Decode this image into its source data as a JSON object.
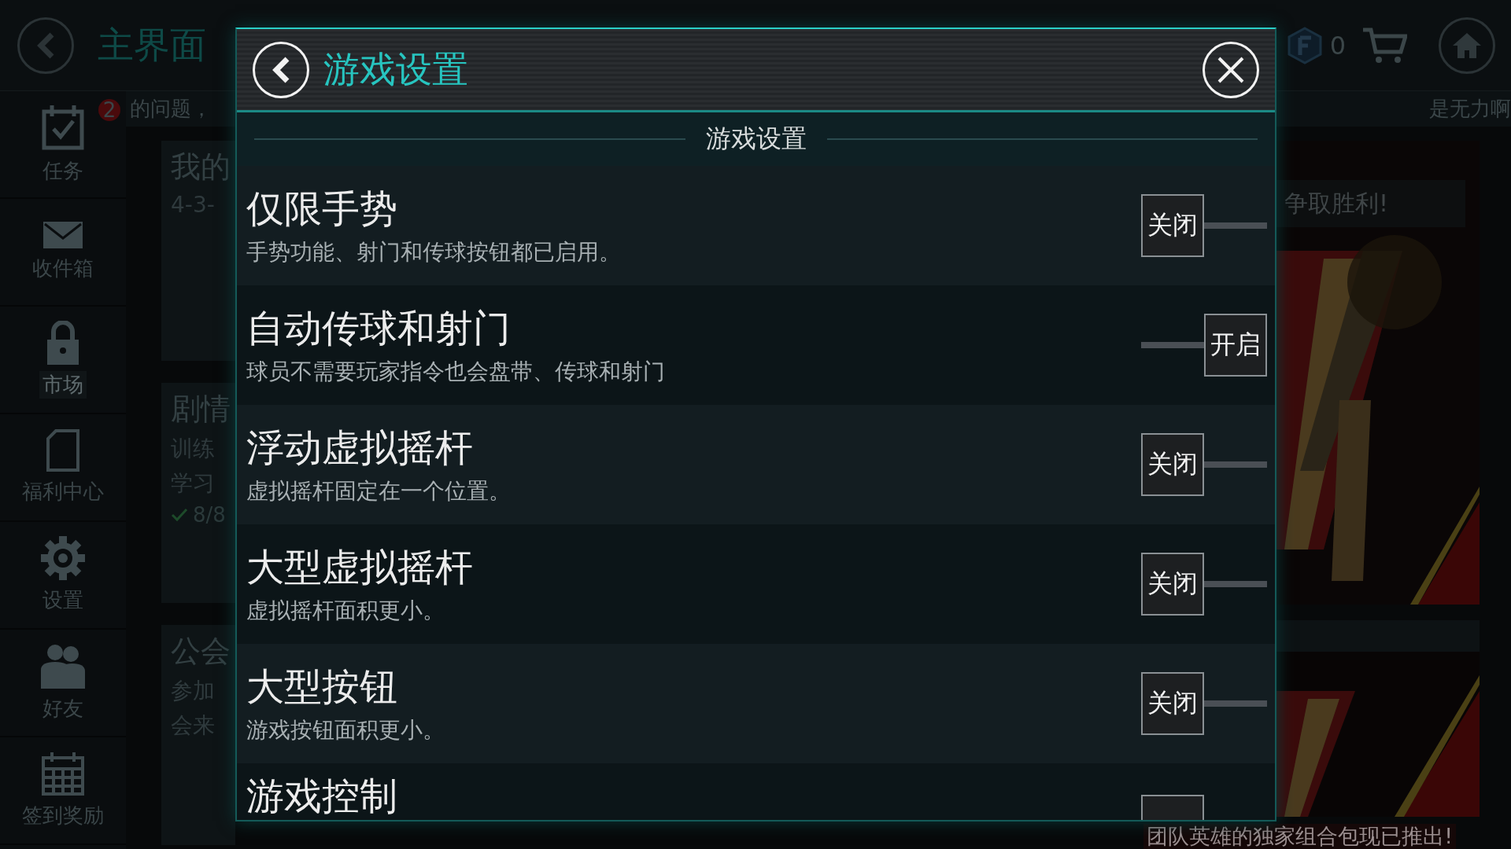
{
  "background": {
    "title": "主界面",
    "badge": "2",
    "ticker_left": "的问题，",
    "ticker_right": "是无力啊",
    "coins": "0",
    "sidebar": [
      {
        "label": "任务",
        "disabled": false
      },
      {
        "label": "收件箱",
        "disabled": false
      },
      {
        "label": "市场",
        "disabled": true
      },
      {
        "label": "福利中心",
        "disabled": false
      },
      {
        "label": "设置",
        "disabled": false
      },
      {
        "label": "好友",
        "disabled": false
      },
      {
        "label": "签到奖励",
        "disabled": false
      }
    ],
    "cards": [
      {
        "title": "我的",
        "lines": [
          "4-3-"
        ]
      },
      {
        "title": "剧情",
        "lines": [
          "训练",
          "学习"
        ],
        "progress": "8/8"
      },
      {
        "title": "公会",
        "lines": [
          "参加",
          "会来"
        ]
      }
    ],
    "banner_text": "争取胜利!",
    "footer_text": "团队英雄的独家组合包现已推出!"
  },
  "dialog": {
    "title": "游戏设置",
    "section": "游戏设置",
    "settings": [
      {
        "title": "仅限手势",
        "description": "手势功能、射门和传球按钮都已启用。",
        "on": false,
        "label": "关闭"
      },
      {
        "title": "自动传球和射门",
        "description": "球员不需要玩家指令也会盘带、传球和射门",
        "on": true,
        "label": "开启"
      },
      {
        "title": "浮动虚拟摇杆",
        "description": "虚拟摇杆固定在一个位置。",
        "on": false,
        "label": "关闭"
      },
      {
        "title": "大型虚拟摇杆",
        "description": "虚拟摇杆面积更小。",
        "on": false,
        "label": "关闭"
      },
      {
        "title": "大型按钮",
        "description": "游戏按钮面积更小。",
        "on": false,
        "label": "关闭"
      },
      {
        "title": "游戏控制",
        "on": false
      }
    ]
  }
}
